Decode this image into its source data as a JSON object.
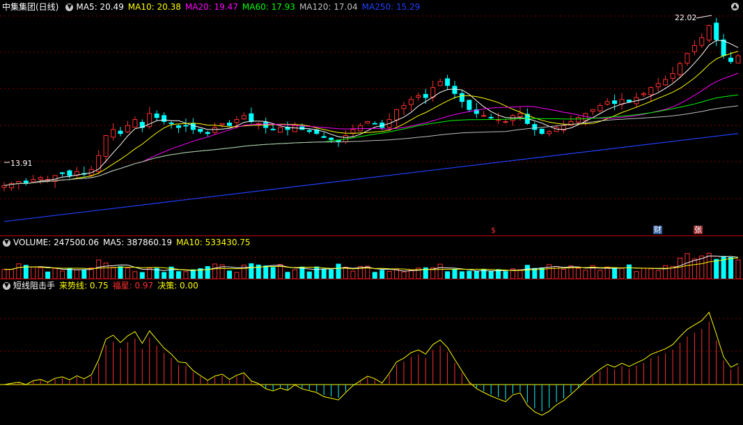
{
  "main": {
    "title": "中集集团(日线)",
    "indicators": [
      {
        "label": "MA5: 20.49",
        "color": "#ffffff"
      },
      {
        "label": "MA10: 20.38",
        "color": "#ffff00"
      },
      {
        "label": "MA20: 19.47",
        "color": "#ff00ff"
      },
      {
        "label": "MA60: 17.93",
        "color": "#00ff00"
      },
      {
        "label": "MA120: 17.04",
        "color": "#c0c0c0"
      },
      {
        "label": "MA250: 15.29",
        "color": "#2040ff"
      }
    ],
    "high_label": "22.02",
    "low_label": "13.91",
    "events": [
      "$",
      "财",
      "张"
    ]
  },
  "volume": {
    "title": "VOLUME: 247500.06",
    "indicators": [
      {
        "label": "MA5: 387860.19",
        "color": "#ffffff"
      },
      {
        "label": "MA10: 533430.75",
        "color": "#ffff00"
      }
    ]
  },
  "oscillator": {
    "title": "短线阻击手",
    "indicators": [
      {
        "label": "来势线: 0.75",
        "color": "#ffff00"
      },
      {
        "label": "福星: 0.97",
        "color": "#ff3030"
      },
      {
        "label": "决策: 0.00",
        "color": "#ffff00"
      }
    ]
  },
  "colors": {
    "up": "#ff3030",
    "down": "#00ffff",
    "grid": "#8b0000",
    "separator": "#c00000"
  },
  "chart_data": {
    "type": "candlestick",
    "price_range": [
      11.5,
      23.0
    ],
    "high": 22.02,
    "low": 13.91,
    "close_approx": [
      14.0,
      14.1,
      14.2,
      14.1,
      14.3,
      14.4,
      14.3,
      14.5,
      14.6,
      14.5,
      14.7,
      14.6,
      14.8,
      15.5,
      16.5,
      16.8,
      16.6,
      17.0,
      17.3,
      16.9,
      17.6,
      17.4,
      17.2,
      17.1,
      16.9,
      17.0,
      16.8,
      16.7,
      16.6,
      16.9,
      17.1,
      17.0,
      17.3,
      17.5,
      17.2,
      17.1,
      16.9,
      16.8,
      16.9,
      16.8,
      17.0,
      16.8,
      16.7,
      16.6,
      16.4,
      16.3,
      16.2,
      16.5,
      16.8,
      17.0,
      17.2,
      17.1,
      16.9,
      17.3,
      17.8,
      18.0,
      18.3,
      18.5,
      18.4,
      18.9,
      19.2,
      19.0,
      18.6,
      18.2,
      17.8,
      17.6,
      17.5,
      17.4,
      17.3,
      17.2,
      17.5,
      17.6,
      17.1,
      16.8,
      16.6,
      16.7,
      16.9,
      17.0,
      17.2,
      17.4,
      17.6,
      17.8,
      18.0,
      18.2,
      18.1,
      18.3,
      18.2,
      18.4,
      18.6,
      18.9,
      19.1,
      19.3,
      19.6,
      20.1,
      20.6,
      21.0,
      21.4,
      22.0,
      21.3,
      20.5,
      20.2,
      20.49
    ]
  }
}
